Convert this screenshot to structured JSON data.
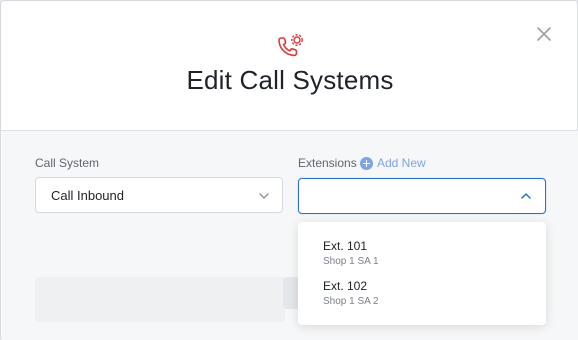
{
  "modal": {
    "title": "Edit Call Systems",
    "header_icon": "phone-gear-icon",
    "close_icon": "close-icon"
  },
  "form": {
    "call_system": {
      "label": "Call System",
      "value": "Call Inbound"
    },
    "extensions": {
      "label": "Extensions",
      "add_new_label": "Add New",
      "value": "",
      "options": [
        {
          "title": "Ext. 101",
          "subtitle": "Shop 1 SA 1"
        },
        {
          "title": "Ext. 102",
          "subtitle": "Shop 1 SA 2"
        }
      ]
    }
  },
  "colors": {
    "accent": "#2a6fd6",
    "link": "#7ea4e4",
    "icon_red": "#d93a3a"
  }
}
